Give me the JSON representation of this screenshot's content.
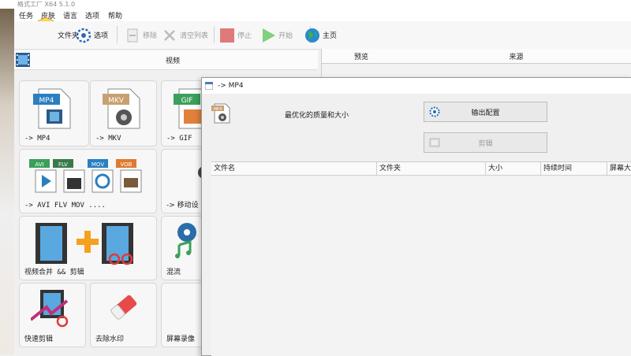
{
  "window": {
    "title": "格式工厂 X64 5.1.0"
  },
  "menu": [
    "任务",
    "皮肤",
    "语言",
    "选项",
    "帮助"
  ],
  "toolbar": {
    "output_folder": "文件夹",
    "options": "选项",
    "remove": "移除",
    "clear_list": "清空列表",
    "stop": "停止",
    "start": "开始",
    "home": "主页"
  },
  "category": {
    "label": "视频"
  },
  "tiles": [
    {
      "badge": "MP4",
      "label": "-> MP4"
    },
    {
      "badge": "MKV",
      "label": "-> MKV"
    },
    {
      "badge": "GIF",
      "label": "-> GIF"
    },
    {
      "badges": [
        "AVI",
        "FLV",
        "MOV",
        "VOB"
      ],
      "label": "-> AVI FLV MOV ...."
    },
    {
      "label": "-> 移动设"
    },
    {
      "label": "视频合并 && 剪辑"
    },
    {
      "label": "混流"
    },
    {
      "label": "快速剪辑"
    },
    {
      "label": "去除水印"
    },
    {
      "label": "屏幕录像"
    }
  ],
  "right_pane": {
    "columns": [
      "预览",
      "来源"
    ]
  },
  "dialog": {
    "title": "-> MP4",
    "badge": "MP4",
    "quality": "最优化的质量和大小",
    "output_settings": "输出配置",
    "edit": "剪辑",
    "columns": [
      "文件名",
      "文件夹",
      "大小",
      "持续时间",
      "屏幕大"
    ]
  },
  "colors": {
    "accent": "#1e62c8",
    "mp4": "#2a7fc0",
    "mkv": "#c8a070",
    "gif": "#3aa05a",
    "stop": "#e07a7a",
    "start": "#7fd07f"
  }
}
